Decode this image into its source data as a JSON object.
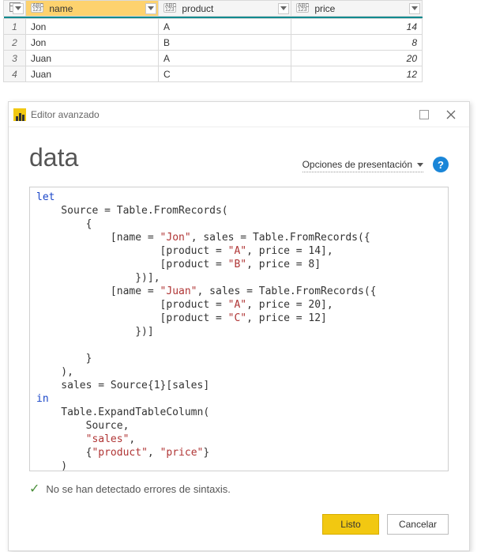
{
  "grid": {
    "columns": [
      {
        "name": "name",
        "type_label_top": "ABC",
        "type_label_bot": "123",
        "selected": true
      },
      {
        "name": "product",
        "type_label_top": "ABC",
        "type_label_bot": "123",
        "selected": false
      },
      {
        "name": "price",
        "type_label_top": "ABC",
        "type_label_bot": "123",
        "selected": false
      }
    ],
    "rows": [
      {
        "n": "1",
        "name": "Jon",
        "product": "A",
        "price": "14"
      },
      {
        "n": "2",
        "name": "Jon",
        "product": "B",
        "price": "8"
      },
      {
        "n": "3",
        "name": "Juan",
        "product": "A",
        "price": "20"
      },
      {
        "n": "4",
        "name": "Juan",
        "product": "C",
        "price": "12"
      }
    ]
  },
  "editor": {
    "window_title": "Editor avanzado",
    "query_name": "data",
    "presentation_label": "Opciones de presentación",
    "help_glyph": "?",
    "code_lines": [
      {
        "t": "kw",
        "pad": 0,
        "text": "let"
      },
      {
        "t": "plain",
        "pad": 4,
        "text": "Source = Table.FromRecords("
      },
      {
        "t": "plain",
        "pad": 8,
        "text": "{"
      },
      {
        "t": "mix",
        "pad": 12,
        "parts": [
          "[name = ",
          {
            "s": "\"Jon\""
          },
          ", sales = Table.FromRecords({"
        ]
      },
      {
        "t": "mix",
        "pad": 20,
        "parts": [
          "[product = ",
          {
            "s": "\"A\""
          },
          ", price = 14],"
        ]
      },
      {
        "t": "mix",
        "pad": 20,
        "parts": [
          "[product = ",
          {
            "s": "\"B\""
          },
          ", price = 8]"
        ]
      },
      {
        "t": "plain",
        "pad": 16,
        "text": "})],"
      },
      {
        "t": "mix",
        "pad": 12,
        "parts": [
          "[name = ",
          {
            "s": "\"Juan\""
          },
          ", sales = Table.FromRecords({"
        ]
      },
      {
        "t": "mix",
        "pad": 20,
        "parts": [
          "[product = ",
          {
            "s": "\"A\""
          },
          ", price = 20],"
        ]
      },
      {
        "t": "mix",
        "pad": 20,
        "parts": [
          "[product = ",
          {
            "s": "\"C\""
          },
          ", price = 12]"
        ]
      },
      {
        "t": "plain",
        "pad": 16,
        "text": "})]"
      },
      {
        "t": "plain",
        "pad": 0,
        "text": ""
      },
      {
        "t": "plain",
        "pad": 8,
        "text": "}"
      },
      {
        "t": "plain",
        "pad": 4,
        "text": "),"
      },
      {
        "t": "plain",
        "pad": 4,
        "text": "sales = Source{1}[sales]"
      },
      {
        "t": "kw",
        "pad": 0,
        "text": "in"
      },
      {
        "t": "plain",
        "pad": 4,
        "text": "Table.ExpandTableColumn("
      },
      {
        "t": "plain",
        "pad": 8,
        "text": "Source,"
      },
      {
        "t": "mix",
        "pad": 8,
        "parts": [
          {
            "s": "\"sales\""
          },
          ","
        ]
      },
      {
        "t": "mix",
        "pad": 8,
        "parts": [
          "{",
          {
            "s": "\"product\""
          },
          ", ",
          {
            "s": "\"price\""
          },
          "}"
        ]
      },
      {
        "t": "plain",
        "pad": 4,
        "text": ")"
      }
    ],
    "status_text": "No se han detectado errores de sintaxis.",
    "ok_label": "Listo",
    "cancel_label": "Cancelar"
  }
}
